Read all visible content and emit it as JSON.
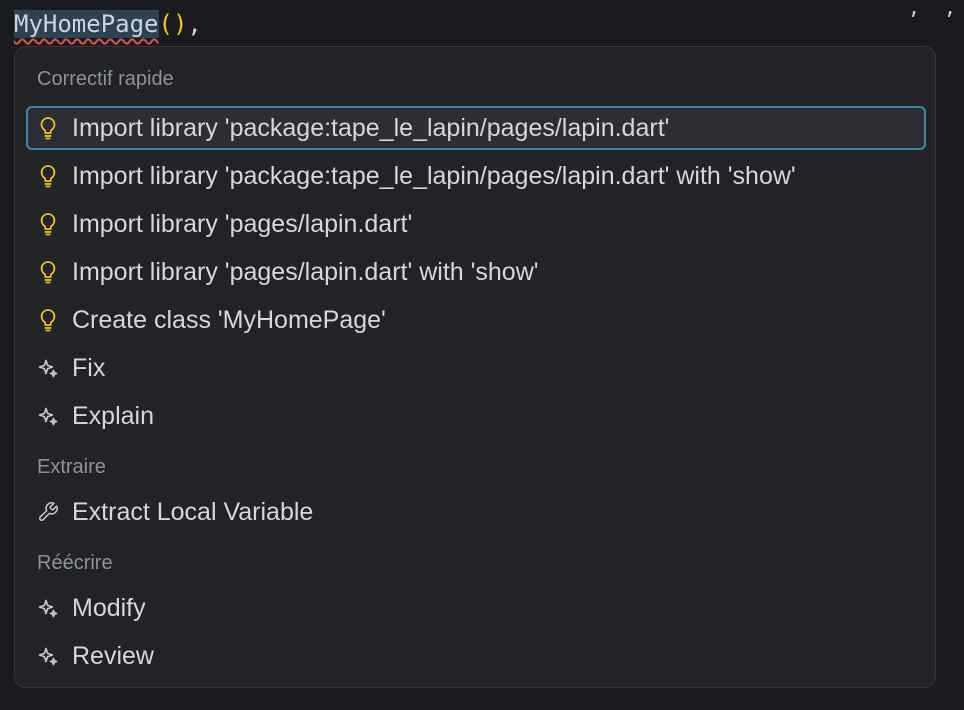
{
  "editor": {
    "identifier": "MyHomePage",
    "parens": "()",
    "comma": ","
  },
  "menu": {
    "sections": [
      {
        "title": "Correctif rapide"
      },
      {
        "title": "Extraire"
      },
      {
        "title": "Réécrire"
      }
    ],
    "items": [
      {
        "label": "Import library 'package:tape_le_lapin/pages/lapin.dart'",
        "icon": "lightbulb-icon"
      },
      {
        "label": "Import library 'package:tape_le_lapin/pages/lapin.dart' with 'show'",
        "icon": "lightbulb-icon"
      },
      {
        "label": "Import library 'pages/lapin.dart'",
        "icon": "lightbulb-icon"
      },
      {
        "label": "Import library 'pages/lapin.dart' with 'show'",
        "icon": "lightbulb-icon"
      },
      {
        "label": "Create class 'MyHomePage'",
        "icon": "lightbulb-icon"
      },
      {
        "label": "Fix",
        "icon": "sparkle-icon"
      },
      {
        "label": "Explain",
        "icon": "sparkle-icon"
      },
      {
        "label": "Extract Local Variable",
        "icon": "wrench-icon"
      },
      {
        "label": "Modify",
        "icon": "sparkle-icon"
      },
      {
        "label": "Review",
        "icon": "sparkle-icon"
      }
    ]
  },
  "colors": {
    "background": "#1a1b1e",
    "menu_background": "#222326",
    "selection_border": "#3f86ad",
    "lightbulb": "#f0c419"
  }
}
